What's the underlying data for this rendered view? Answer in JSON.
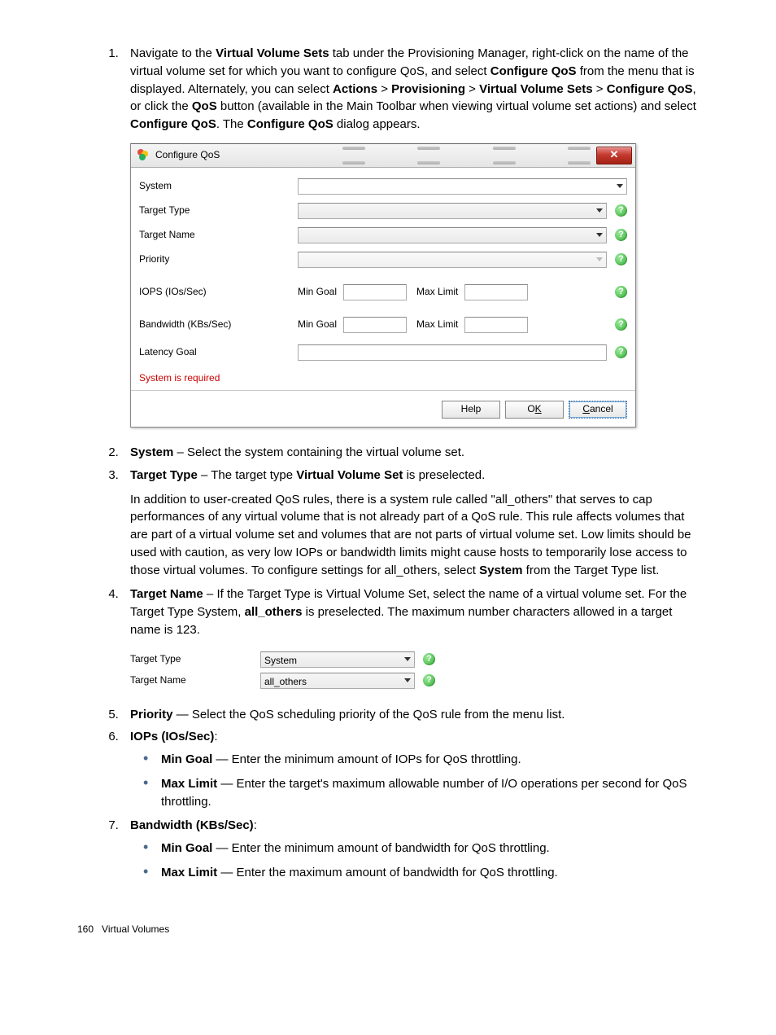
{
  "list": {
    "item1": {
      "text_a": "Navigate to the ",
      "b1": "Virtual Volume Sets",
      "text_b": " tab under the Provisioning Manager, right-click on the name of the virtual volume set for which you want to configure QoS, and select ",
      "b2": "Configure QoS",
      "text_c": " from the menu that is displayed. Alternately, you can select ",
      "b3": "Actions",
      "gt1": " > ",
      "b4": "Provisioning",
      "gt2": " > ",
      "b5": "Virtual Volume Sets",
      "gt3": " > ",
      "b6": "Configure QoS",
      "text_d": ", or click the ",
      "b7": "QoS",
      "text_e": " button (available in the Main Toolbar when viewing virtual volume set actions) and select ",
      "b8": "Configure QoS",
      "text_f": ". The ",
      "b9": "Configure QoS",
      "text_g": " dialog appears."
    },
    "item2": {
      "b": "System",
      "t": " – Select the system containing the virtual volume set."
    },
    "item3": {
      "b": "Target Type",
      "t1": " – The target type ",
      "b2": "Virtual Volume Set",
      "t2": " is preselected.",
      "para": "In addition to user-created QoS rules, there is a system rule called \"all_others\" that serves to cap performances of any virtual volume that is not already part of a QoS rule. This rule affects volumes that are part of a virtual volume set and volumes that are not parts of virtual volume set. Low limits should be used with caution, as very low IOPs or bandwidth limits might cause hosts to temporarily lose access to those virtual volumes. To configure settings for all_others, select ",
      "b3": "System",
      "t3": " from the Target Type list."
    },
    "item4": {
      "b": "Target Name",
      "t1": " – If the Target Type is Virtual Volume Set, select the name of a virtual volume set. For the Target Type System, ",
      "b2": "all_others",
      "t2": " is preselected. The maximum number characters allowed in a target name is 123."
    },
    "item5": {
      "b": "Priority",
      "t": "  — Select the QoS scheduling priority of the QoS rule from the menu list."
    },
    "item6": {
      "b": "IOPs (IOs/Sec)",
      "colon": ":",
      "sub1b": "Min Goal",
      "sub1t": " — Enter the minimum amount of IOPs for QoS throttling.",
      "sub2b": "Max Limit",
      "sub2t": " — Enter the target's maximum allowable number of I/O operations per second for QoS throttling."
    },
    "item7": {
      "b": "Bandwidth (KBs/Sec)",
      "colon": ":",
      "sub1b": "Min Goal",
      "sub1t": " — Enter the minimum amount of bandwidth for QoS throttling.",
      "sub2b": "Max Limit",
      "sub2t": " — Enter the maximum amount of bandwidth for QoS throttling."
    }
  },
  "dialog1": {
    "title": "Configure QoS",
    "rows": {
      "system": "System",
      "target_type": "Target Type",
      "target_name": "Target Name",
      "priority": "Priority",
      "iops": "IOPS (IOs/Sec)",
      "bandwidth": "Bandwidth (KBs/Sec)",
      "latency": "Latency Goal",
      "min_goal": "Min Goal",
      "max_limit": "Max Limit"
    },
    "error": "System is required",
    "buttons": {
      "help": "Help",
      "ok_pre": "O",
      "ok_u": "K",
      "cancel_u": "C",
      "cancel_post": "ancel"
    },
    "help_icon": "?"
  },
  "dialog2": {
    "rows": {
      "target_type": "Target Type",
      "target_name": "Target Name",
      "val_system": "System",
      "val_all_others": "all_others"
    }
  },
  "footer": {
    "page": "160",
    "section": "Virtual Volumes"
  }
}
